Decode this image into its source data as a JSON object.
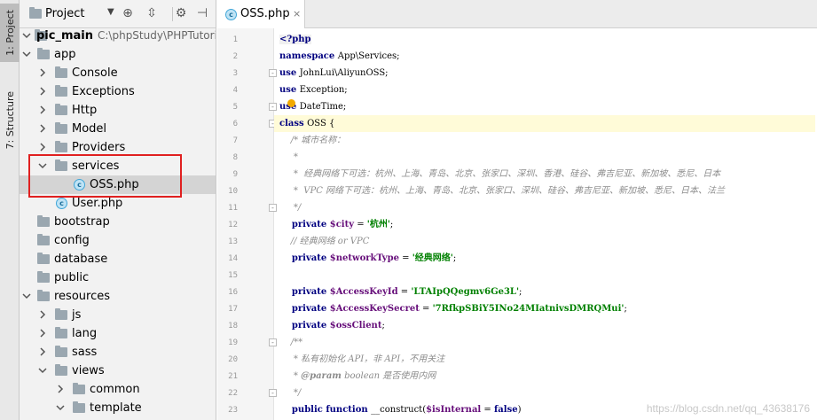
{
  "side_tabs": {
    "project": "1: Project",
    "structure": "7: Structure"
  },
  "project_panel": {
    "title": "Project",
    "root": {
      "name": "pic_main",
      "path": "C:\\phpStudy\\PHPTutorial"
    },
    "tree": [
      {
        "label": "app"
      },
      {
        "label": "Console"
      },
      {
        "label": "Exceptions"
      },
      {
        "label": "Http"
      },
      {
        "label": "Model"
      },
      {
        "label": "Providers"
      },
      {
        "label": "services"
      },
      {
        "label": "OSS.php"
      },
      {
        "label": "User.php"
      },
      {
        "label": "bootstrap"
      },
      {
        "label": "config"
      },
      {
        "label": "database"
      },
      {
        "label": "public"
      },
      {
        "label": "resources"
      },
      {
        "label": "js"
      },
      {
        "label": "lang"
      },
      {
        "label": "sass"
      },
      {
        "label": "views"
      },
      {
        "label": "common"
      },
      {
        "label": "template"
      }
    ]
  },
  "editor": {
    "tab": {
      "label": "OSS.php",
      "close": "×"
    },
    "line_numbers": [
      "1",
      "2",
      "3",
      "4",
      "5",
      "6",
      "7",
      "8",
      "9",
      "10",
      "11",
      "12",
      "13",
      "14",
      "15",
      "16",
      "17",
      "18",
      "19",
      "20",
      "21",
      "22",
      "23"
    ],
    "lines": [
      [
        {
          "t": "<?php",
          "c": "tag"
        }
      ],
      [
        {
          "t": "namespace ",
          "c": "kw"
        },
        {
          "t": "App\\Services;",
          "c": "plain"
        }
      ],
      [
        {
          "t": "use ",
          "c": "kw"
        },
        {
          "t": "JohnLui\\AliyunOSS;",
          "c": "plain"
        }
      ],
      [
        {
          "t": "use ",
          "c": "kw"
        },
        {
          "t": "Exception;",
          "c": "plain"
        }
      ],
      [
        {
          "t": "use ",
          "c": "kw"
        },
        {
          "t": "DateTime;",
          "c": "plain"
        }
      ],
      [
        {
          "t": "class ",
          "c": "kw"
        },
        {
          "t": "OSS {",
          "c": "plain"
        }
      ],
      [
        {
          "t": "    /* 城市名称：",
          "c": "cm"
        }
      ],
      [
        {
          "t": "     *",
          "c": "cm"
        }
      ],
      [
        {
          "t": "     *  经典网络下可选：杭州、上海、青岛、北京、张家口、深圳、香港、硅谷、弗吉尼亚、新加坡、悉尼、日本",
          "c": "cm"
        }
      ],
      [
        {
          "t": "     *  VPC 网络下可选：杭州、上海、青岛、北京、张家口、深圳、硅谷、弗吉尼亚、新加坡、悉尼、日本、法兰",
          "c": "cm"
        }
      ],
      [
        {
          "t": "     */",
          "c": "cm"
        }
      ],
      [
        {
          "t": "    private ",
          "c": "kw"
        },
        {
          "t": "$city",
          "c": "var"
        },
        {
          "t": " = ",
          "c": "plain"
        },
        {
          "t": "'杭州'",
          "c": "str"
        },
        {
          "t": ";",
          "c": "plain"
        }
      ],
      [
        {
          "t": "    // 经典网络 or VPC",
          "c": "cm"
        }
      ],
      [
        {
          "t": "    private ",
          "c": "kw"
        },
        {
          "t": "$networkType",
          "c": "var"
        },
        {
          "t": " = ",
          "c": "plain"
        },
        {
          "t": "'经典网络'",
          "c": "str"
        },
        {
          "t": ";",
          "c": "plain"
        }
      ],
      [
        {
          "t": "",
          "c": "plain"
        }
      ],
      [
        {
          "t": "    private ",
          "c": "kw"
        },
        {
          "t": "$AccessKeyId",
          "c": "var"
        },
        {
          "t": " = ",
          "c": "plain"
        },
        {
          "t": "'LTAIpQQegmv6Ge3L'",
          "c": "str"
        },
        {
          "t": ";",
          "c": "plain"
        }
      ],
      [
        {
          "t": "    private ",
          "c": "kw"
        },
        {
          "t": "$AccessKeySecret",
          "c": "var"
        },
        {
          "t": " = ",
          "c": "plain"
        },
        {
          "t": "'7RfkpSBiY5INo24MIatnivsDMRQMui'",
          "c": "str"
        },
        {
          "t": ";",
          "c": "plain"
        }
      ],
      [
        {
          "t": "    private ",
          "c": "kw"
        },
        {
          "t": "$ossClient",
          "c": "var"
        },
        {
          "t": ";",
          "c": "plain"
        }
      ],
      [
        {
          "t": "    /**",
          "c": "cm"
        }
      ],
      [
        {
          "t": "     * 私有初始化 API，非 API，不用关注",
          "c": "cm"
        }
      ],
      [
        {
          "t": "     * ",
          "c": "cm"
        },
        {
          "t": "@param",
          "c": "ctag"
        },
        {
          "t": " boolean 是否使用内网",
          "c": "cm"
        }
      ],
      [
        {
          "t": "     */",
          "c": "cm"
        }
      ],
      [
        {
          "t": "    public ",
          "c": "kw"
        },
        {
          "t": "function ",
          "c": "kw"
        },
        {
          "t": "__construct(",
          "c": "plain"
        },
        {
          "t": "$isInternal",
          "c": "var"
        },
        {
          "t": " = ",
          "c": "plain"
        },
        {
          "t": "false",
          "c": "kw"
        },
        {
          "t": ")",
          "c": "plain"
        }
      ]
    ]
  },
  "watermark": "https://blog.csdn.net/qq_43638176"
}
